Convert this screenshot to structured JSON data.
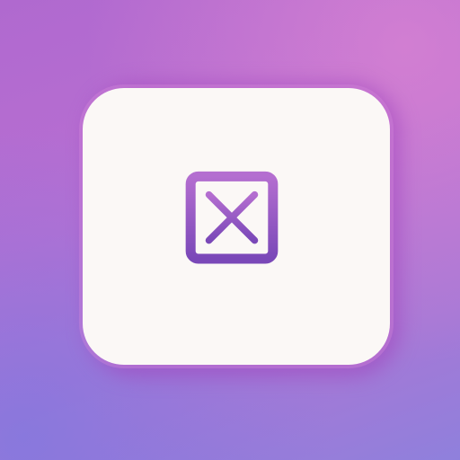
{
  "app": {
    "icon_name": "close-icon",
    "colors": {
      "background_top": "#b86fd2",
      "background_bottom": "#8f80dc",
      "card": "#fbf8f6",
      "icon_light": "#b46ed0",
      "icon_dark": "#7a48b8"
    }
  }
}
